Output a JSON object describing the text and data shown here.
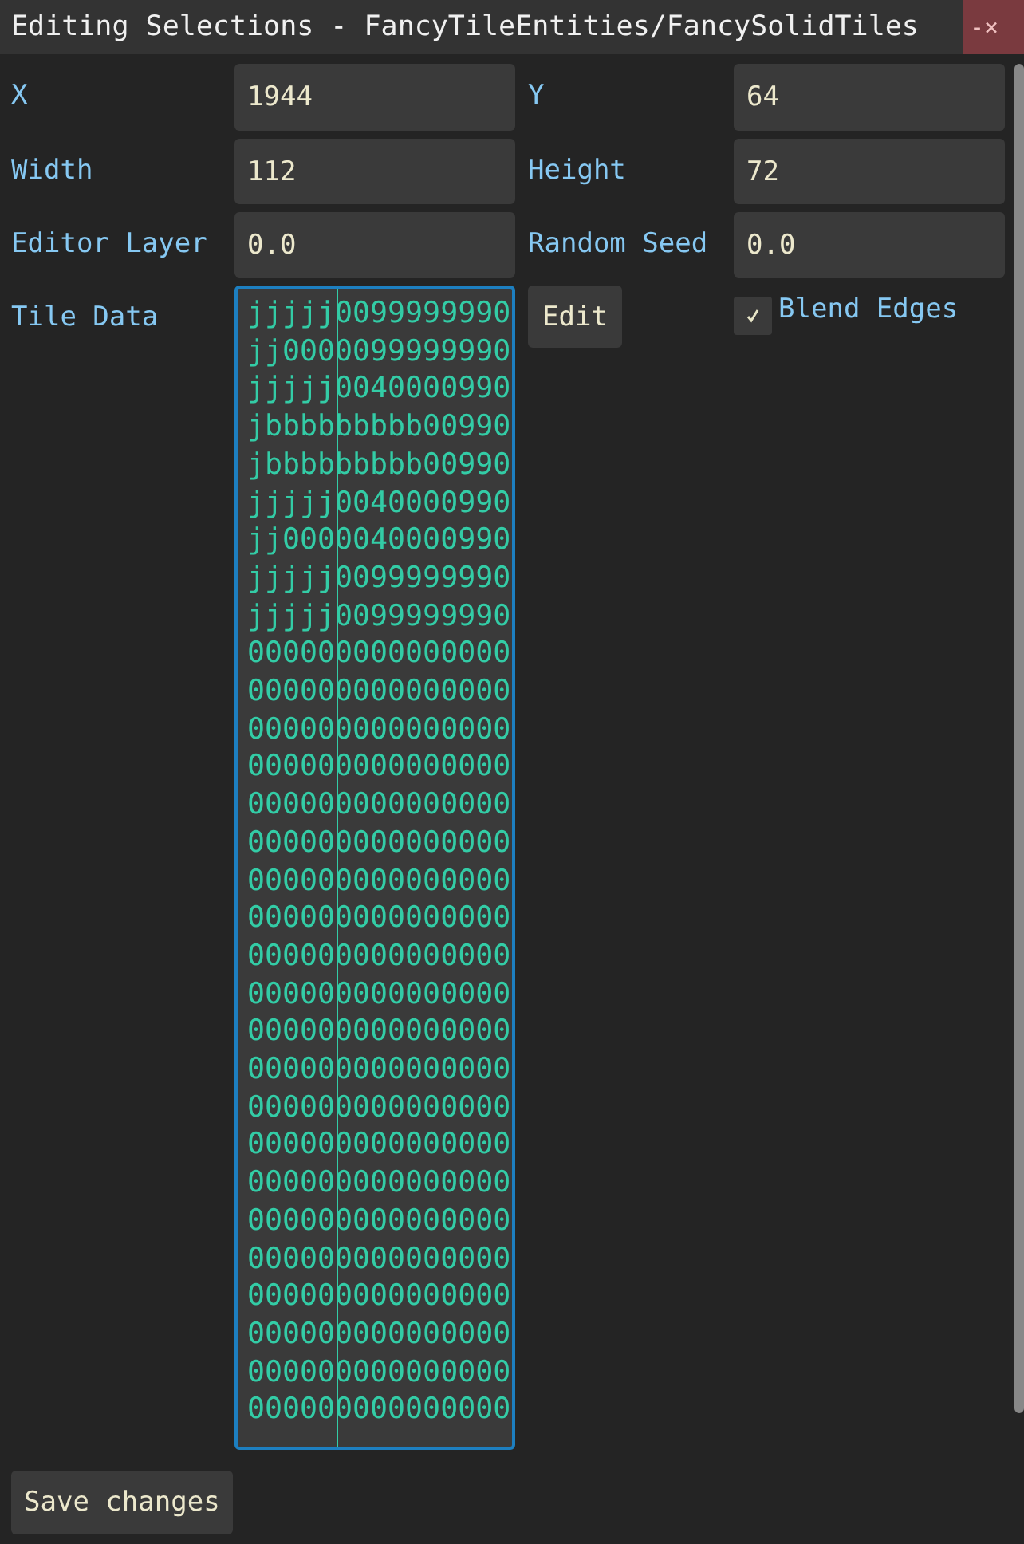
{
  "window": {
    "title": "Editing Selections - FancyTileEntities/FancySolidTiles",
    "close": "-×"
  },
  "fields": [
    {
      "label": "X",
      "value": "1944"
    },
    {
      "label": "Y",
      "value": "64"
    },
    {
      "label": "Width",
      "value": "112"
    },
    {
      "label": "Height",
      "value": "72"
    },
    {
      "label": "Editor Layer",
      "value": "0.0"
    },
    {
      "label": "Random Seed",
      "value": "0.0"
    }
  ],
  "tile_data": {
    "label": "Tile Data",
    "rows": [
      "jjjjj0099999990",
      "jj0000099999990",
      "jjjjj0040000990",
      "jbbbbbbbbb00990",
      "jbbbbbbbbb00990",
      "jjjjj0040000990",
      "jj0000040000990",
      "jjjjj0099999990",
      "jjjjj0099999990",
      "000000000000000",
      "000000000000000",
      "000000000000000",
      "000000000000000",
      "000000000000000",
      "000000000000000",
      "000000000000000",
      "000000000000000",
      "000000000000000",
      "000000000000000",
      "000000000000000",
      "000000000000000",
      "000000000000000",
      "000000000000000",
      "000000000000000",
      "000000000000000",
      "000000000000000",
      "000000000000000",
      "000000000000000",
      "000000000000000",
      "000000000000000"
    ],
    "edit_button": "Edit"
  },
  "blend_edges": {
    "label": "Blend Edges",
    "checked": true
  },
  "save_button": "Save changes"
}
